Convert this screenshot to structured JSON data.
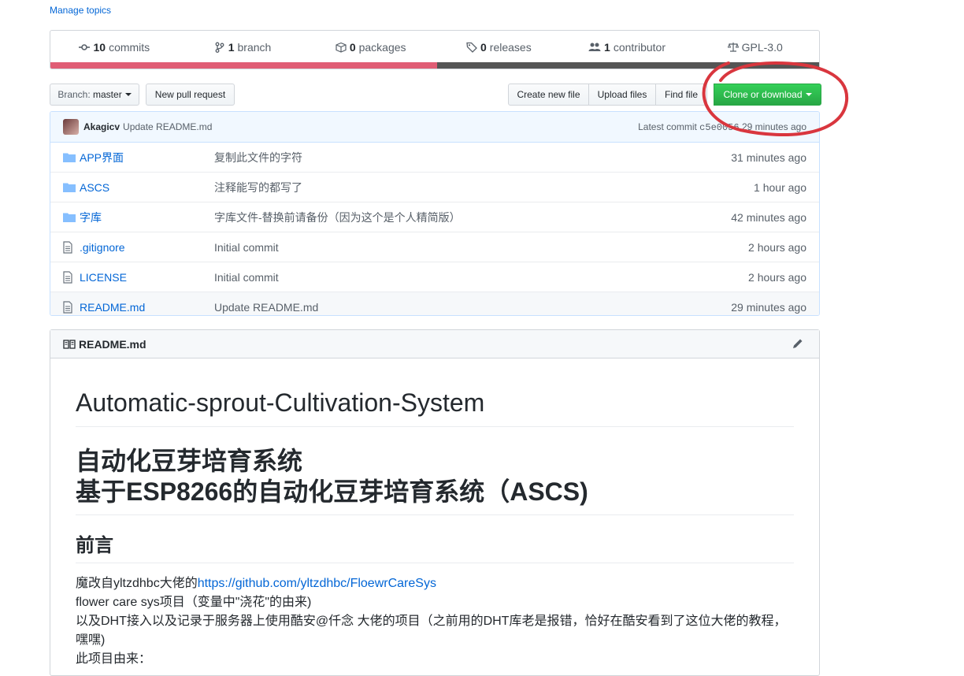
{
  "topics": {
    "manage_label": "Manage topics"
  },
  "summary": {
    "commits_count": "10",
    "commits_label": "commits",
    "branch_count": "1",
    "branch_label": "branch",
    "packages_count": "0",
    "packages_label": "packages",
    "releases_count": "0",
    "releases_label": "releases",
    "contributor_count": "1",
    "contributor_label": "contributor",
    "license_label": "GPL-3.0"
  },
  "language_bar": {
    "colors": [
      "#e05d75",
      "#555555"
    ],
    "shares_percent": [
      50.3,
      49.7
    ]
  },
  "toolbar": {
    "branch_prefix": "Branch:",
    "branch_name": "master",
    "new_pr_label": "New pull request",
    "create_file_label": "Create new file",
    "upload_files_label": "Upload files",
    "find_file_label": "Find file",
    "clone_label": "Clone or download"
  },
  "latest_commit": {
    "author": "Akagicv",
    "message": "Update README.md",
    "prefix": "Latest commit",
    "sha": "c5e0056",
    "age": "29 minutes ago"
  },
  "files": [
    {
      "icon": "folder-icon",
      "name": "APP界面",
      "message": "复制此文件的字符",
      "age": "31 minutes ago"
    },
    {
      "icon": "folder-icon",
      "name": "ASCS",
      "message": "注释能写的都写了",
      "age": "1 hour ago"
    },
    {
      "icon": "folder-icon",
      "name": "字库",
      "message": "字库文件-替换前请备份（因为这个是个人精简版）",
      "age": "42 minutes ago"
    },
    {
      "icon": "file-icon",
      "name": ".gitignore",
      "message": "Initial commit",
      "age": "2 hours ago"
    },
    {
      "icon": "file-icon",
      "name": "LICENSE",
      "message": "Initial commit",
      "age": "2 hours ago"
    },
    {
      "icon": "file-icon",
      "name": "README.md",
      "message": "Update README.md",
      "age": "29 minutes ago"
    }
  ],
  "readme": {
    "filename": "README.md",
    "title_en": "Automatic-sprout-Cultivation-System",
    "title_cn_line1": "自动化豆芽培育系统",
    "title_cn_line2": "基于ESP8266的自动化豆芽培育系统（ASCS)",
    "section_heading": "前言",
    "para1_prefix": "魔改自yltzdhbc大佬的",
    "para1_link": "https://github.com/yltzdhbc/FloewrCareSys",
    "para2": "flower care sys项目（变量中\"浇花\"的由来)",
    "para3": "以及DHT接入以及记录于服务器上使用酷安@仟念 大佬的项目（之前用的DHT库老是报错，恰好在酷安看到了这位大佬的教程，嘿嘿)",
    "para4": "此项目由来："
  },
  "annotation": {
    "color": "#d9363e"
  }
}
